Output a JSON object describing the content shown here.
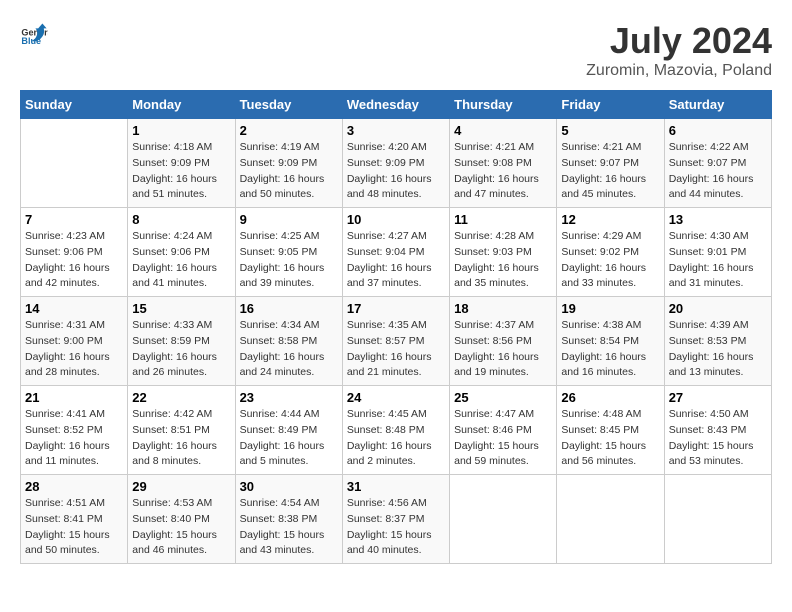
{
  "header": {
    "logo_general": "General",
    "logo_blue": "Blue",
    "title": "July 2024",
    "subtitle": "Zuromin, Mazovia, Poland"
  },
  "days_of_week": [
    "Sunday",
    "Monday",
    "Tuesday",
    "Wednesday",
    "Thursday",
    "Friday",
    "Saturday"
  ],
  "weeks": [
    [
      {
        "day": "",
        "info": ""
      },
      {
        "day": "1",
        "info": "Sunrise: 4:18 AM\nSunset: 9:09 PM\nDaylight: 16 hours\nand 51 minutes."
      },
      {
        "day": "2",
        "info": "Sunrise: 4:19 AM\nSunset: 9:09 PM\nDaylight: 16 hours\nand 50 minutes."
      },
      {
        "day": "3",
        "info": "Sunrise: 4:20 AM\nSunset: 9:09 PM\nDaylight: 16 hours\nand 48 minutes."
      },
      {
        "day": "4",
        "info": "Sunrise: 4:21 AM\nSunset: 9:08 PM\nDaylight: 16 hours\nand 47 minutes."
      },
      {
        "day": "5",
        "info": "Sunrise: 4:21 AM\nSunset: 9:07 PM\nDaylight: 16 hours\nand 45 minutes."
      },
      {
        "day": "6",
        "info": "Sunrise: 4:22 AM\nSunset: 9:07 PM\nDaylight: 16 hours\nand 44 minutes."
      }
    ],
    [
      {
        "day": "7",
        "info": "Sunrise: 4:23 AM\nSunset: 9:06 PM\nDaylight: 16 hours\nand 42 minutes."
      },
      {
        "day": "8",
        "info": "Sunrise: 4:24 AM\nSunset: 9:06 PM\nDaylight: 16 hours\nand 41 minutes."
      },
      {
        "day": "9",
        "info": "Sunrise: 4:25 AM\nSunset: 9:05 PM\nDaylight: 16 hours\nand 39 minutes."
      },
      {
        "day": "10",
        "info": "Sunrise: 4:27 AM\nSunset: 9:04 PM\nDaylight: 16 hours\nand 37 minutes."
      },
      {
        "day": "11",
        "info": "Sunrise: 4:28 AM\nSunset: 9:03 PM\nDaylight: 16 hours\nand 35 minutes."
      },
      {
        "day": "12",
        "info": "Sunrise: 4:29 AM\nSunset: 9:02 PM\nDaylight: 16 hours\nand 33 minutes."
      },
      {
        "day": "13",
        "info": "Sunrise: 4:30 AM\nSunset: 9:01 PM\nDaylight: 16 hours\nand 31 minutes."
      }
    ],
    [
      {
        "day": "14",
        "info": "Sunrise: 4:31 AM\nSunset: 9:00 PM\nDaylight: 16 hours\nand 28 minutes."
      },
      {
        "day": "15",
        "info": "Sunrise: 4:33 AM\nSunset: 8:59 PM\nDaylight: 16 hours\nand 26 minutes."
      },
      {
        "day": "16",
        "info": "Sunrise: 4:34 AM\nSunset: 8:58 PM\nDaylight: 16 hours\nand 24 minutes."
      },
      {
        "day": "17",
        "info": "Sunrise: 4:35 AM\nSunset: 8:57 PM\nDaylight: 16 hours\nand 21 minutes."
      },
      {
        "day": "18",
        "info": "Sunrise: 4:37 AM\nSunset: 8:56 PM\nDaylight: 16 hours\nand 19 minutes."
      },
      {
        "day": "19",
        "info": "Sunrise: 4:38 AM\nSunset: 8:54 PM\nDaylight: 16 hours\nand 16 minutes."
      },
      {
        "day": "20",
        "info": "Sunrise: 4:39 AM\nSunset: 8:53 PM\nDaylight: 16 hours\nand 13 minutes."
      }
    ],
    [
      {
        "day": "21",
        "info": "Sunrise: 4:41 AM\nSunset: 8:52 PM\nDaylight: 16 hours\nand 11 minutes."
      },
      {
        "day": "22",
        "info": "Sunrise: 4:42 AM\nSunset: 8:51 PM\nDaylight: 16 hours\nand 8 minutes."
      },
      {
        "day": "23",
        "info": "Sunrise: 4:44 AM\nSunset: 8:49 PM\nDaylight: 16 hours\nand 5 minutes."
      },
      {
        "day": "24",
        "info": "Sunrise: 4:45 AM\nSunset: 8:48 PM\nDaylight: 16 hours\nand 2 minutes."
      },
      {
        "day": "25",
        "info": "Sunrise: 4:47 AM\nSunset: 8:46 PM\nDaylight: 15 hours\nand 59 minutes."
      },
      {
        "day": "26",
        "info": "Sunrise: 4:48 AM\nSunset: 8:45 PM\nDaylight: 15 hours\nand 56 minutes."
      },
      {
        "day": "27",
        "info": "Sunrise: 4:50 AM\nSunset: 8:43 PM\nDaylight: 15 hours\nand 53 minutes."
      }
    ],
    [
      {
        "day": "28",
        "info": "Sunrise: 4:51 AM\nSunset: 8:41 PM\nDaylight: 15 hours\nand 50 minutes."
      },
      {
        "day": "29",
        "info": "Sunrise: 4:53 AM\nSunset: 8:40 PM\nDaylight: 15 hours\nand 46 minutes."
      },
      {
        "day": "30",
        "info": "Sunrise: 4:54 AM\nSunset: 8:38 PM\nDaylight: 15 hours\nand 43 minutes."
      },
      {
        "day": "31",
        "info": "Sunrise: 4:56 AM\nSunset: 8:37 PM\nDaylight: 15 hours\nand 40 minutes."
      },
      {
        "day": "",
        "info": ""
      },
      {
        "day": "",
        "info": ""
      },
      {
        "day": "",
        "info": ""
      }
    ]
  ]
}
